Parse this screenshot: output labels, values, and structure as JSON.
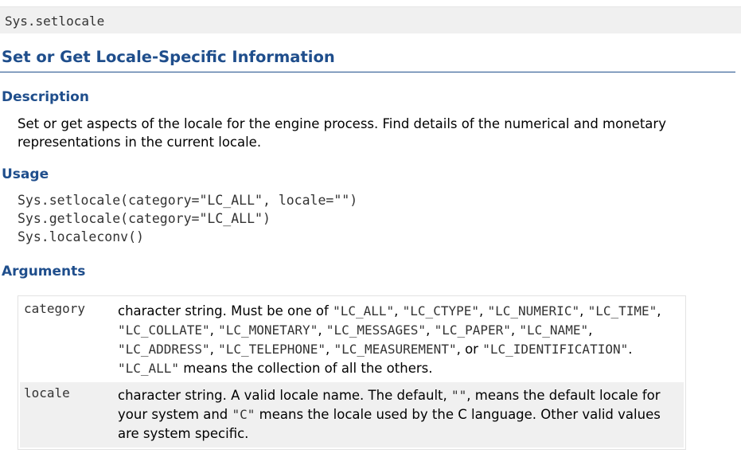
{
  "topbar": {
    "function_name": "Sys.setlocale"
  },
  "title": "Set or Get Locale-Specific Information",
  "description": {
    "heading": "Description",
    "text": "Set or get aspects of the locale for the engine process. Find details of the numerical and monetary representations in the current locale."
  },
  "usage": {
    "heading": "Usage",
    "lines": [
      "Sys.setlocale(category=\"LC_ALL\", locale=\"\")",
      "Sys.getlocale(category=\"LC_ALL\")",
      "Sys.localeconv()"
    ]
  },
  "arguments": {
    "heading": "Arguments",
    "items": [
      {
        "name": "category",
        "desc": {
          "t0": "character string. Must be one of ",
          "c0": "\"LC_ALL\"",
          "t1": ", ",
          "c1": "\"LC_CTYPE\"",
          "t2": ", ",
          "c2": "\"LC_NUMERIC\"",
          "t3": ", ",
          "c3": "\"LC_TIME\"",
          "t4": ", ",
          "c4": "\"LC_COLLATE\"",
          "t5": ", ",
          "c5": "\"LC_MONETARY\"",
          "t6": ", ",
          "c6": "\"LC_MESSAGES\"",
          "t7": ", ",
          "c7": "\"LC_PAPER\"",
          "t8": ", ",
          "c8": "\"LC_NAME\"",
          "t9": ", ",
          "c9": "\"LC_ADDRESS\"",
          "t10": ", ",
          "c10": "\"LC_TELEPHONE\"",
          "t11": ", ",
          "c11": "\"LC_MEASUREMENT\"",
          "t12": ", or ",
          "c12": "\"LC_IDENTIFICATION\"",
          "t13": ". ",
          "c13": "\"LC_ALL\"",
          "t14": " means the collection of all the others."
        }
      },
      {
        "name": "locale",
        "desc": {
          "t0": "character string. A valid locale name. The default, ",
          "c0": "\"\"",
          "t1": ", means the default locale for your system and ",
          "c1": "\"C\"",
          "t2": " means the locale used by the C language. Other valid values are system specific."
        }
      }
    ]
  }
}
